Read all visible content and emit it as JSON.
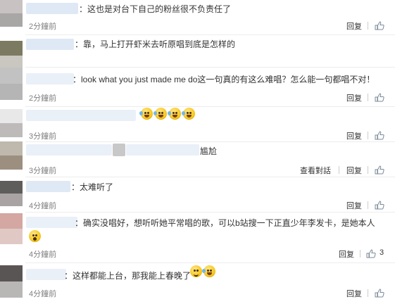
{
  "actions": {
    "reply": "回复",
    "view_conversation": "查看對話"
  },
  "comments": [
    {
      "text": "：这也是对台下自己的粉丝很不负责任了",
      "time": "2分鐘前",
      "reply": "回复",
      "likes": ""
    },
    {
      "text": "：靠，马上打开虾米去听原唱到底是怎样的",
      "time": "",
      "reply": "",
      "likes": ""
    },
    {
      "text": "：look what you just made me do这一句真的有这么难唱？怎么能一句都唱不对！",
      "time": "2分鐘前",
      "reply": "回复",
      "likes": ""
    },
    {
      "text": "",
      "time": "3分鐘前",
      "reply": "回复",
      "likes": "",
      "emojis": [
        "laugh",
        "laugh",
        "laugh",
        "laugh"
      ]
    },
    {
      "text": "尴尬",
      "time": "3分鐘前",
      "reply": "回复",
      "likes": "",
      "view_conversation": "查看對話"
    },
    {
      "text": "：太难听了",
      "time": "4分鐘前",
      "reply": "回复",
      "likes": ""
    },
    {
      "text": "：确实没唱好，想听听她平常唱的歌，可以b站搜一下正直少年李发卡，是她本人",
      "time": "4分鐘前",
      "reply": "回复",
      "likes": "3",
      "emojis": [
        "surprise"
      ]
    },
    {
      "text": "：这样都能上台，那我能上春晚了",
      "time": "4分鐘前",
      "reply": "回复",
      "likes": "",
      "emojis": [
        "smile",
        "laugh"
      ]
    }
  ],
  "icons": {
    "like": "thumbs-up-icon",
    "emoji": "emoji-face-icon"
  },
  "colors": {
    "name_blur": "#dfe9f5",
    "time": "#808080",
    "divider": "#ececec"
  }
}
